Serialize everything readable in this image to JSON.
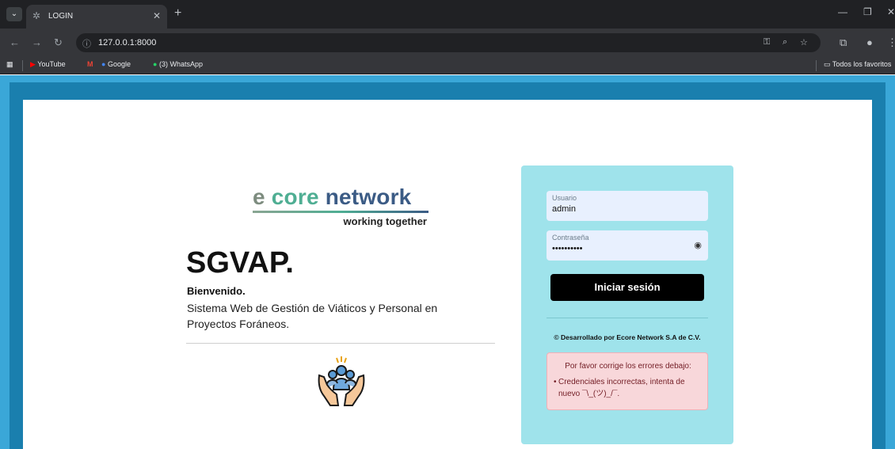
{
  "browser": {
    "tab_title": "LOGIN",
    "url": "127.0.0.1:8000",
    "bookmarks": [
      "YouTube",
      "Google",
      "(3) WhatsApp"
    ],
    "all_bookmarks": "Todos los favoritos"
  },
  "brand": {
    "logo_e": "e",
    "logo_core": "core",
    "logo_network": "network",
    "logo_tagline": "working together",
    "colors": {
      "e": "#7d8c7f",
      "core": "#4fae93",
      "network": "#3b5b85"
    }
  },
  "intro": {
    "title": "SGVAP.",
    "welcome": "Bienvenido.",
    "description": "Sistema Web de Gestión de Viáticos y Personal en Proyectos Foráneos."
  },
  "login": {
    "user_label": "Usuario",
    "user_value": "admin",
    "password_label": "Contraseña",
    "password_value": "••••••••••",
    "submit_label": "Iniciar sesión",
    "credit": "© Desarrollado por Ecore Network S.A de C.V.",
    "error_heading": "Por favor corrige los errores debajo:",
    "error_message": "Credenciales incorrectas, intenta de nuevo ¯\\_(ツ)_/¯."
  },
  "colors": {
    "page_frame": "#3aa7d8",
    "card_bg": "#9fe3eb",
    "button_bg": "#000000",
    "alert_bg": "#f8d7da",
    "alert_text": "#721c24"
  }
}
